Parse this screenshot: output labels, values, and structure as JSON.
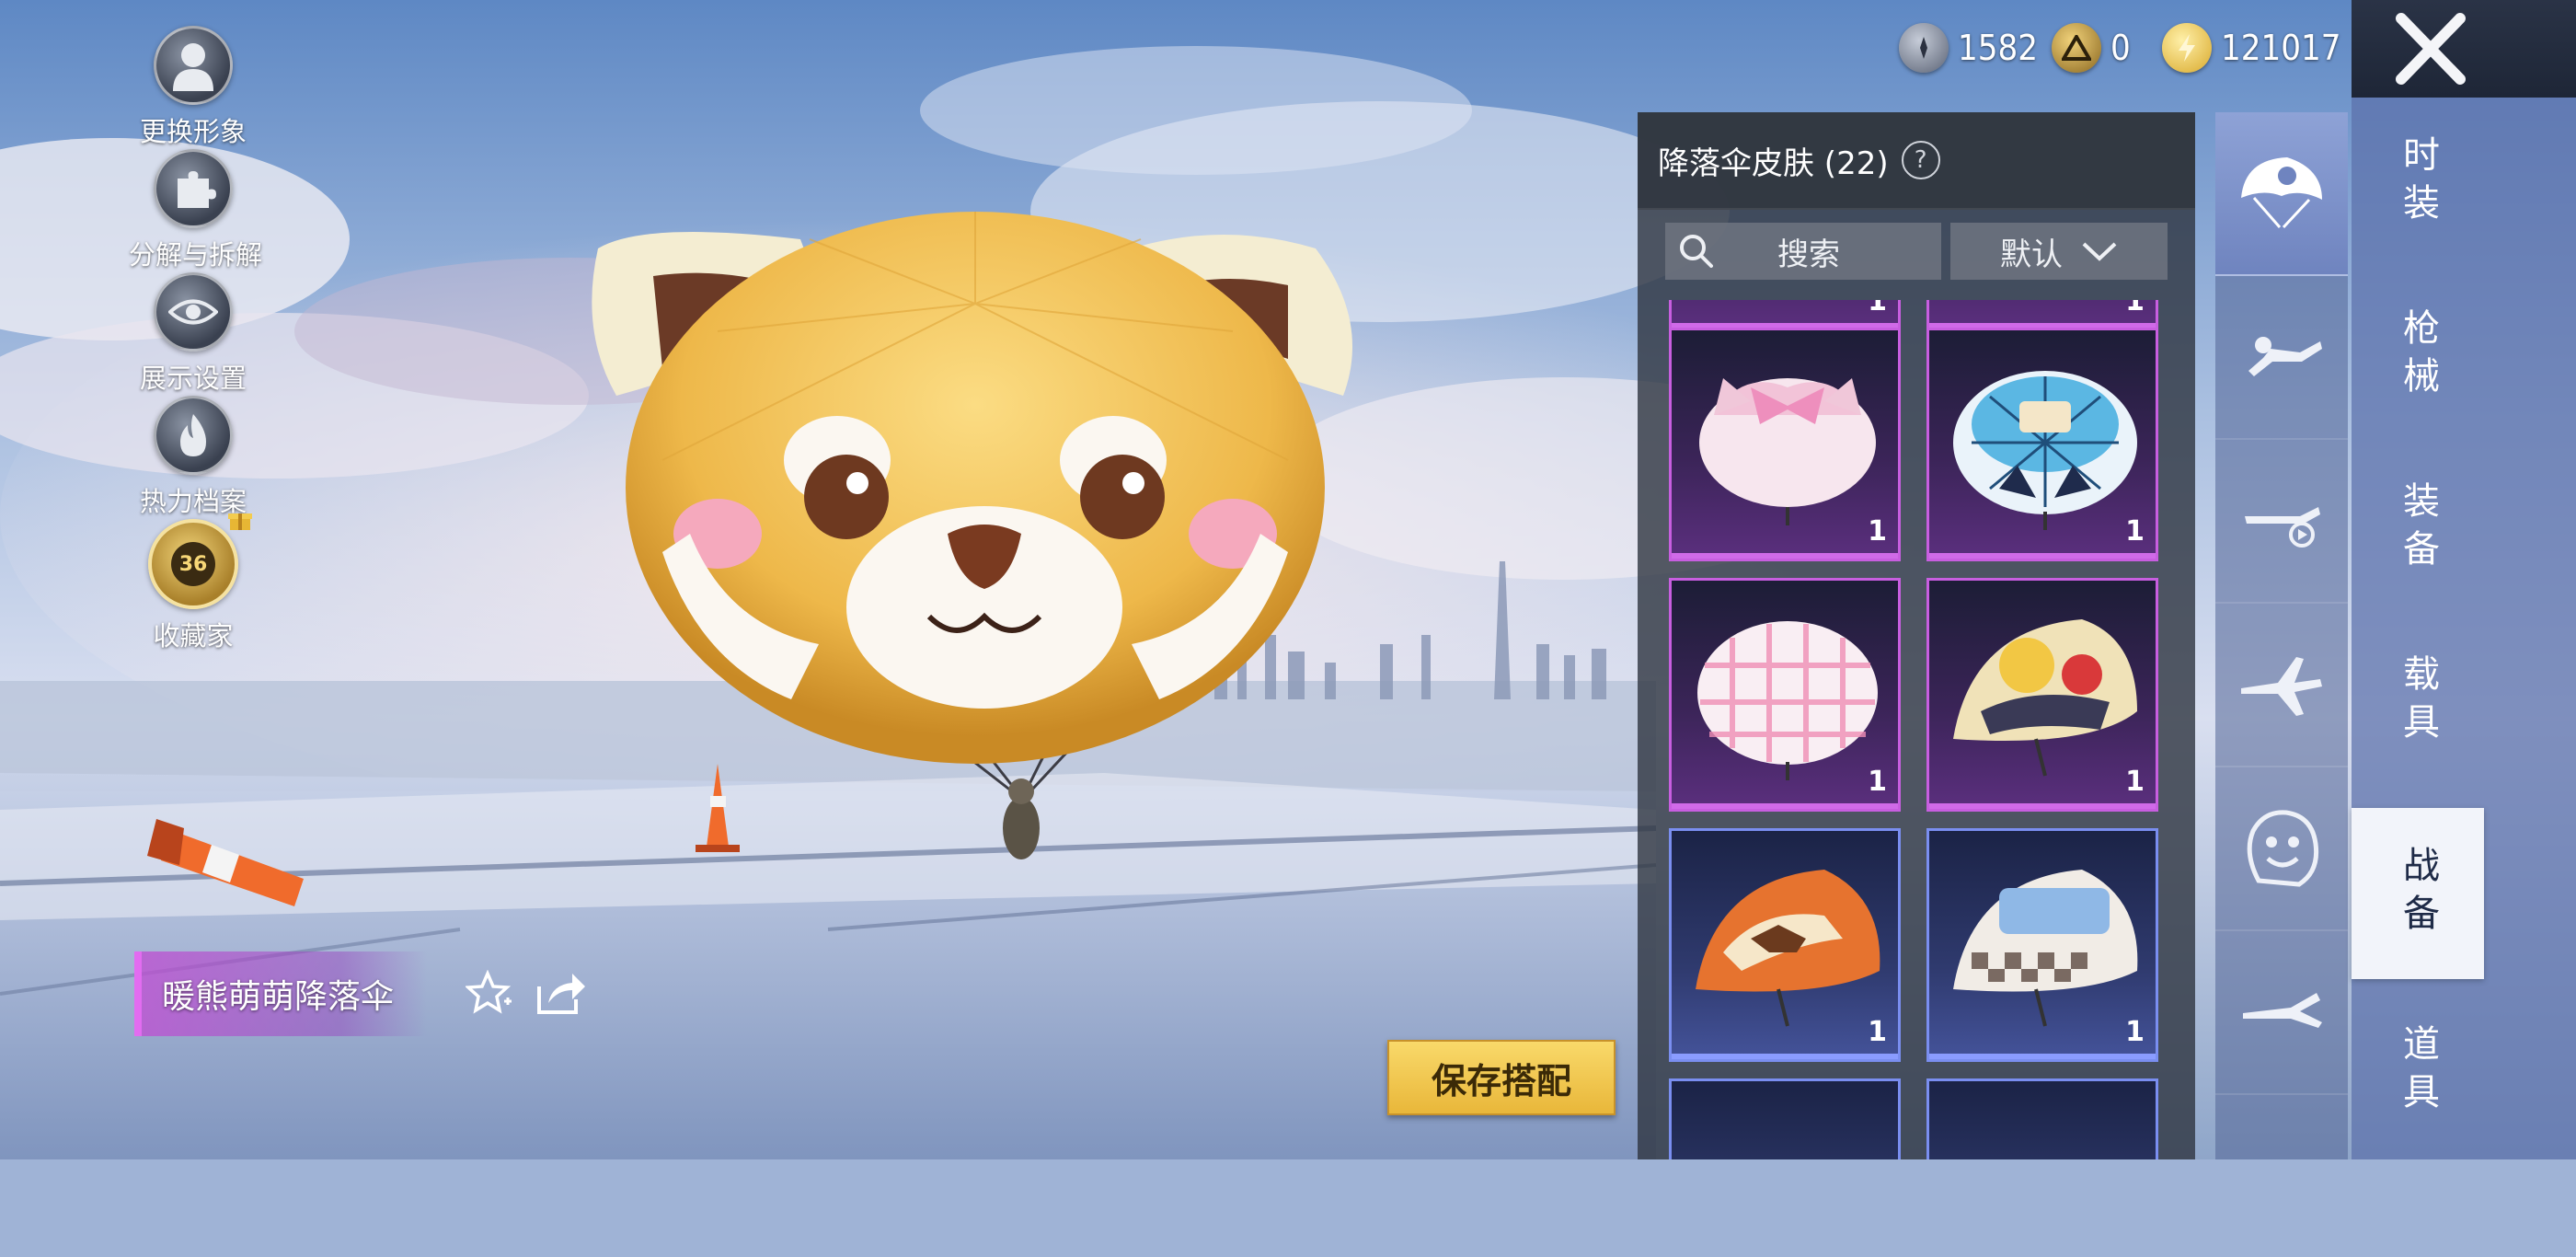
{
  "left_menu": [
    {
      "label": "更换形象",
      "icon": "avatar-icon"
    },
    {
      "label": "分解与拆解",
      "icon": "puzzle-icon"
    },
    {
      "label": "展示设置",
      "icon": "eye-icon"
    },
    {
      "label": "热力档案",
      "icon": "flame-icon"
    },
    {
      "label": "收藏家",
      "icon": "collector-badge-icon",
      "level": "36"
    }
  ],
  "currency": [
    {
      "name": "silver",
      "value": "1582",
      "color": "#7a8396"
    },
    {
      "name": "achievement",
      "value": "0",
      "color": "#c9a33a"
    },
    {
      "name": "bp",
      "value": "121017",
      "color": "#e8c548"
    }
  ],
  "panel": {
    "title": "降落伞皮肤 (22)",
    "search_placeholder": "搜索",
    "sort_label": "默认",
    "partial_top_counts": [
      "1",
      "1"
    ],
    "items": [
      {
        "count": "1",
        "rarity": "purple",
        "icon": "pink-bow-parachute-icon"
      },
      {
        "count": "1",
        "rarity": "purple",
        "icon": "blue-bear-parachute-icon"
      },
      {
        "count": "1",
        "rarity": "purple",
        "icon": "pink-plaid-parachute-icon"
      },
      {
        "count": "1",
        "rarity": "purple",
        "icon": "comic-parachute-icon"
      },
      {
        "count": "1",
        "rarity": "blue",
        "icon": "horse-parachute-icon"
      },
      {
        "count": "1",
        "rarity": "blue",
        "icon": "checker-553-parachute-icon"
      }
    ]
  },
  "categories": [
    {
      "name": "parachute",
      "icon": "parachute-icon",
      "active": true
    },
    {
      "name": "skydiver",
      "icon": "skydiver-icon",
      "active": false
    },
    {
      "name": "plane-trail",
      "icon": "plane-trail-icon",
      "active": false
    },
    {
      "name": "airplane",
      "icon": "airplane-icon",
      "active": false
    },
    {
      "name": "emote",
      "icon": "face-icon",
      "active": false
    },
    {
      "name": "glider",
      "icon": "glider-icon",
      "active": false
    }
  ],
  "main_tabs": [
    {
      "label": "时装",
      "active": false
    },
    {
      "label": "枪械",
      "active": false
    },
    {
      "label": "装备",
      "active": false
    },
    {
      "label": "载具",
      "active": false
    },
    {
      "label": "战备",
      "active": true
    },
    {
      "label": "道具",
      "active": false
    }
  ],
  "item_name": "暖熊萌萌降落伞",
  "save_label": "保存搭配",
  "colors": {
    "accent_purple": "#c85ee0",
    "accent_blue": "#7a8ef0",
    "save_gold": "#f2c94c"
  }
}
